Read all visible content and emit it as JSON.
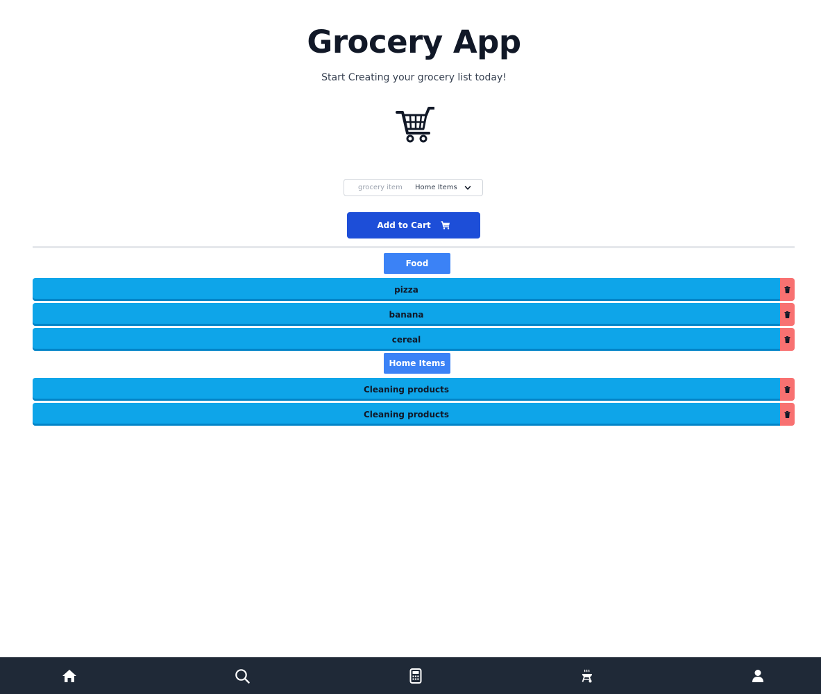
{
  "app": {
    "title": "Grocery App",
    "subtitle": "Start Creating your grocery list today!"
  },
  "form": {
    "item_placeholder": "grocery item",
    "item_value": "",
    "category_selected": "Home Items",
    "add_label": "Add to Cart"
  },
  "categories": [
    {
      "name": "Food",
      "items": [
        "pizza",
        "banana",
        "cereal"
      ]
    },
    {
      "name": "Home Items",
      "items": [
        "Cleaning products",
        "Cleaning products"
      ]
    }
  ],
  "nav": {
    "items": [
      "home-icon",
      "search-icon",
      "calculator-icon",
      "grill-icon",
      "user-icon"
    ]
  },
  "colors": {
    "primary_button": "#1d4ed8",
    "category_badge": "#3b82f6",
    "item_row": "#0ea5e9",
    "delete_button": "#f87171",
    "nav_background": "#1f2937"
  }
}
